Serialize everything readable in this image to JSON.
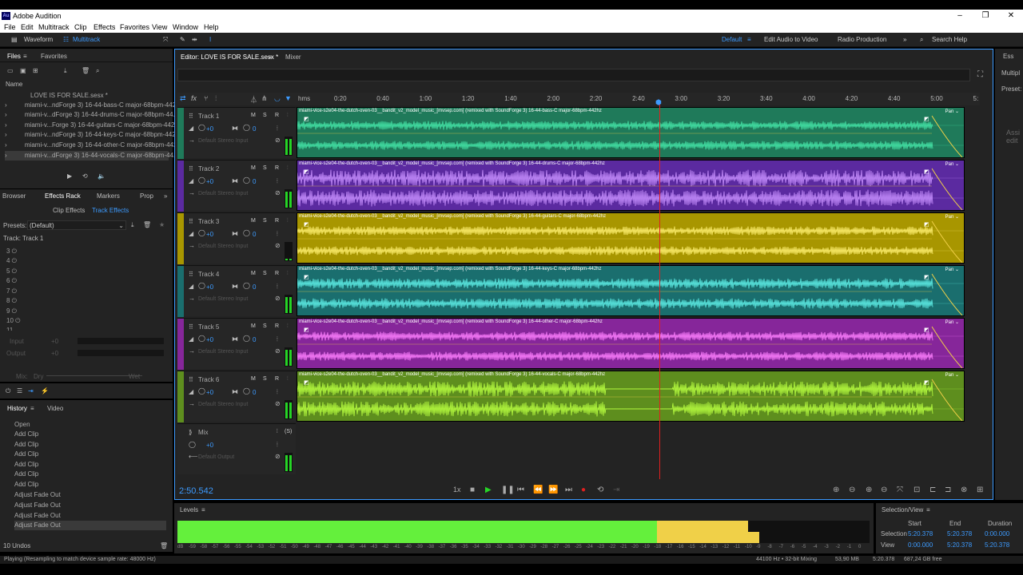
{
  "app": {
    "title": "Adobe Audition",
    "logo": "Au",
    "minimize": "–",
    "maximize": "❐",
    "close": "✕"
  },
  "menu": [
    "File",
    "Edit",
    "Multitrack",
    "Clip",
    "Effects",
    "Favorites",
    "View",
    "Window",
    "Help"
  ],
  "toolbar": {
    "waveform": "Waveform",
    "multitrack": "Multitrack",
    "workspaces": [
      "Default",
      "Edit Audio to Video",
      "Radio Production"
    ],
    "search_placeholder": "Search Help"
  },
  "files": {
    "tabs": [
      "Files",
      "Favorites"
    ],
    "column_name": "Name",
    "items": [
      "LOVE IS FOR SALE.sesx *",
      "miami-v...ndForge 3) 16-44-bass-C major-68bpm-442",
      "miami-v...dForge 3) 16-44-drums-C major-68bpm-44.",
      "miami-v...Forge 3) 16-44-guitars-C major-68bpm-442",
      "miami-v...ndForge 3) 16-44-keys-C major-68bpm-442",
      "miami-v...ndForge 3) 16-44-other-C major-68bpm-442",
      "miami-v...dForge 3) 16-44-vocals-C major-68bpm-44."
    ]
  },
  "effects": {
    "tabs": [
      "Browser",
      "Effects Rack",
      "Markers",
      "Prop"
    ],
    "subtabs": [
      "Clip Effects",
      "Track Effects"
    ],
    "presets_label": "Presets:",
    "preset_value": "(Default)",
    "track_label": "Track: Track 1",
    "slots": [
      "3",
      "4",
      "5",
      "6",
      "7",
      "8",
      "9",
      "10",
      "11"
    ],
    "input_label": "Input",
    "output_label": "Output",
    "mix_label": "Mix:",
    "dry": "Dry",
    "wet": "Wet",
    "pct": "100 %",
    "db_in": "+0",
    "db_out": "+0",
    "scale": [
      "dB",
      "-48",
      "-36",
      "-24",
      "-12",
      "0"
    ]
  },
  "history": {
    "tabs": [
      "History",
      "Video"
    ],
    "items": [
      "Open",
      "Add Clip",
      "Add Clip",
      "Add Clip",
      "Add Clip",
      "Add Clip",
      "Add Clip",
      "Adjust Fade Out",
      "Adjust Fade Out",
      "Adjust Fade Out",
      "Adjust Fade Out"
    ],
    "undos": "10 Undos"
  },
  "editor": {
    "tab": "Editor: LOVE IS FOR SALE.sesx *",
    "mixer": "Mixer",
    "ruler_unit": "hms",
    "ruler": [
      "0:20",
      "0:40",
      "1:00",
      "1:20",
      "1:40",
      "2:00",
      "2:20",
      "2:40",
      "3:00",
      "3:20",
      "3:40",
      "4:00",
      "4:20",
      "4:40",
      "5:00",
      "5:"
    ],
    "time": "2:50.542",
    "rate": "1x"
  },
  "tracks": [
    {
      "name": "Track 1",
      "vol": "+0",
      "pan": "0",
      "io": "Default Stereo Input",
      "clip": "miami-vice-s2e04-the-dutch-oven-03__bandit_v2_model_music_[mvsep.com] (remixed with SoundForge 3) 16-44-bass-C major-68bpm-442hz",
      "color": "#1f7a5a",
      "wave": "#45e6a8",
      "stripe": "#1f7a5a"
    },
    {
      "name": "Track 2",
      "vol": "+0",
      "pan": "0",
      "io": "Default Stereo Input",
      "clip": "miami-vice-s2e04-the-dutch-oven-03__bandit_v2_model_music_[mvsep.com] (remixed with SoundForge 3) 16-44-drums-C major-68bpm-442hz",
      "color": "#5b2aa0",
      "wave": "#c890ff",
      "stripe": "#5b2aa0"
    },
    {
      "name": "Track 3",
      "vol": "+0",
      "pan": "0",
      "io": "Default Stereo Input",
      "clip": "miami-vice-s2e04-the-dutch-oven-03__bandit_v2_model_music_[mvsep.com] (remixed with SoundForge 3) 16-44-guitars-C major-68bpm-442hz",
      "color": "#a89600",
      "wave": "#fff070",
      "stripe": "#a89600"
    },
    {
      "name": "Track 4",
      "vol": "+0",
      "pan": "0",
      "io": "Default Stereo Input",
      "clip": "miami-vice-s2e04-the-dutch-oven-03__bandit_v2_model_music_[mvsep.com] (remixed with SoundForge 3) 16-44-keys-C major-68bpm-442hz",
      "color": "#1a6e6e",
      "wave": "#5ff0e8",
      "stripe": "#1a6e6e"
    },
    {
      "name": "Track 5",
      "vol": "+0",
      "pan": "0",
      "io": "Default Stereo Input",
      "clip": "miami-vice-s2e04-the-dutch-oven-03__bandit_v2_model_music_[mvsep.com] (remixed with SoundForge 3) 16-44-other-C major-68bpm-442hz",
      "color": "#86269a",
      "wave": "#ff80ff",
      "stripe": "#86269a"
    },
    {
      "name": "Track 6",
      "vol": "+0",
      "pan": "0",
      "io": "Default Stereo Input",
      "clip": "miami-vice-s2e04-the-dutch-oven-03__bandit_v2_model_music_[mvsep.com] (remixed with SoundForge 3) 16-44-vocals-C major-68bpm-442hz",
      "color": "#5e8e1e",
      "wave": "#b8ff40",
      "stripe": "#5e8e1e"
    }
  ],
  "mix": {
    "name": "Mix",
    "vol": "+0",
    "io": "Default Output"
  },
  "clip_pan": "Pan",
  "levels": {
    "title": "Levels",
    "scale": [
      "dB",
      "-59",
      "-58",
      "-57",
      "-56",
      "-55",
      "-54",
      "-53",
      "-52",
      "-51",
      "-50",
      "-49",
      "-48",
      "-47",
      "-46",
      "-45",
      "-44",
      "-43",
      "-42",
      "-41",
      "-40",
      "-39",
      "-38",
      "-37",
      "-36",
      "-35",
      "-34",
      "-33",
      "-32",
      "-31",
      "-30",
      "-29",
      "-28",
      "-27",
      "-26",
      "-25",
      "-24",
      "-23",
      "-22",
      "-21",
      "-20",
      "-19",
      "-18",
      "-17",
      "-16",
      "-15",
      "-14",
      "-13",
      "-12",
      "-11",
      "-10",
      "-9",
      "-8",
      "-7",
      "-6",
      "-5",
      "-4",
      "-3",
      "-2",
      "-1",
      "0"
    ]
  },
  "selview": {
    "title": "Selection/View",
    "headers": [
      "Start",
      "End",
      "Duration"
    ],
    "rows": [
      {
        "label": "Selection",
        "start": "5:20.378",
        "end": "5:20.378",
        "dur": "0:00.000"
      },
      {
        "label": "View",
        "start": "0:00.000",
        "end": "5:20.378",
        "dur": "5:20.378"
      }
    ]
  },
  "status": {
    "left": "Playing (Resampling to match device sample rate: 48000 Hz)",
    "rate": "44100 Hz • 32-bit Mixing",
    "mem": "53,90 MB",
    "dur": "5:20.378",
    "free": "687,24 GB free"
  },
  "right_panel": {
    "tab": "Ess",
    "item": "Multipl",
    "presets": "Preset:",
    "hint": "Assi edit"
  }
}
